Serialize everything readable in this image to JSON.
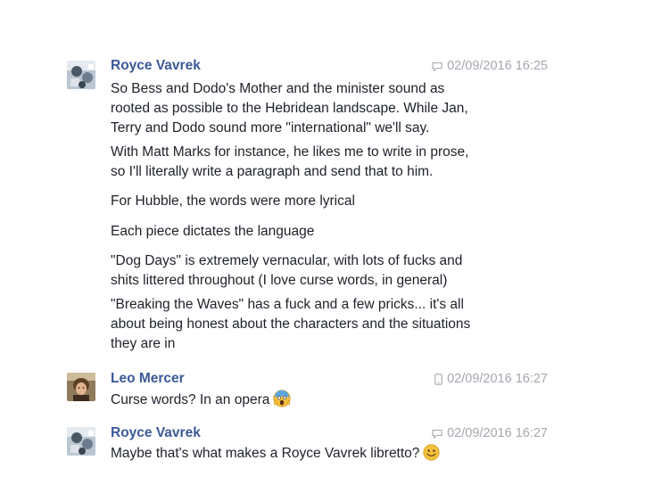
{
  "conversation": {
    "messages": [
      {
        "sender": "Royce Vavrek",
        "device_icon": "chat-bubble-icon",
        "timestamp": "02/09/2016 16:25",
        "paragraphs": [
          [
            "So Bess and Dodo's Mother and the minister sound as",
            "rooted as possible to the Hebridean landscape.  While Jan,",
            "Terry and Dodo sound more \"international\" we'll say."
          ],
          [
            "With Matt Marks for instance, he likes me to write in prose,",
            "so I'll literally write a paragraph and send that to him."
          ],
          [
            "For Hubble, the words were more lyrical"
          ],
          [
            "Each piece dictates the language"
          ],
          [
            "\"Dog Days\" is extremely vernacular, with lots of fucks and",
            "shits littered throughout (I love curse words, in general)"
          ],
          [
            "\"Breaking the Waves\" has a fuck and a few pricks... it's all",
            "about being honest about the characters and the situations",
            "they are in"
          ]
        ]
      },
      {
        "sender": "Leo Mercer",
        "device_icon": "mobile-phone-icon",
        "timestamp": "02/09/2016 16:27",
        "text": "Curse words? In an opera",
        "emoji": "screaming-in-fear-emoji"
      },
      {
        "sender": "Royce Vavrek",
        "device_icon": "chat-bubble-icon",
        "timestamp": "02/09/2016 16:27",
        "text": "Maybe that's what makes a Royce Vavrek libretto?",
        "emoji": "smiling-face-emoji"
      }
    ]
  },
  "colors": {
    "sender_name": "#3b5998",
    "timestamp": "#a4a8b0",
    "body_text": "#1d2129",
    "background": "#ffffff"
  }
}
